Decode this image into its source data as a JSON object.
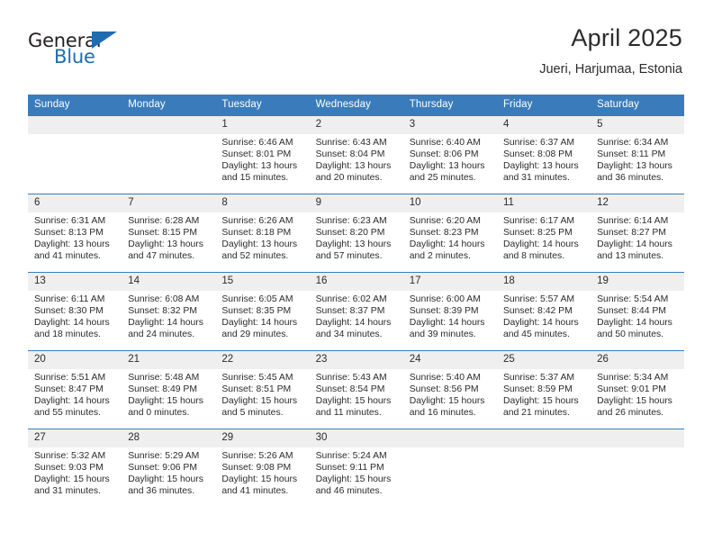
{
  "brand": {
    "name_top": "General",
    "name_bottom": "Blue",
    "triangle_icon": "triangle-icon",
    "accent_color": "#1f6cb0"
  },
  "header": {
    "title": "April 2025",
    "subtitle": "Jueri, Harjumaa, Estonia"
  },
  "theme": {
    "header_row_color": "#3a7cbb",
    "daynum_strip_color": "#efefef",
    "text_color": "#2b2b2b"
  },
  "weekdays": [
    "Sunday",
    "Monday",
    "Tuesday",
    "Wednesday",
    "Thursday",
    "Friday",
    "Saturday"
  ],
  "weeks": [
    [
      {
        "day": "",
        "sunrise": "",
        "sunset": "",
        "daylight": ""
      },
      {
        "day": "",
        "sunrise": "",
        "sunset": "",
        "daylight": ""
      },
      {
        "day": "1",
        "sunrise": "Sunrise: 6:46 AM",
        "sunset": "Sunset: 8:01 PM",
        "daylight": "Daylight: 13 hours and 15 minutes."
      },
      {
        "day": "2",
        "sunrise": "Sunrise: 6:43 AM",
        "sunset": "Sunset: 8:04 PM",
        "daylight": "Daylight: 13 hours and 20 minutes."
      },
      {
        "day": "3",
        "sunrise": "Sunrise: 6:40 AM",
        "sunset": "Sunset: 8:06 PM",
        "daylight": "Daylight: 13 hours and 25 minutes."
      },
      {
        "day": "4",
        "sunrise": "Sunrise: 6:37 AM",
        "sunset": "Sunset: 8:08 PM",
        "daylight": "Daylight: 13 hours and 31 minutes."
      },
      {
        "day": "5",
        "sunrise": "Sunrise: 6:34 AM",
        "sunset": "Sunset: 8:11 PM",
        "daylight": "Daylight: 13 hours and 36 minutes."
      }
    ],
    [
      {
        "day": "6",
        "sunrise": "Sunrise: 6:31 AM",
        "sunset": "Sunset: 8:13 PM",
        "daylight": "Daylight: 13 hours and 41 minutes."
      },
      {
        "day": "7",
        "sunrise": "Sunrise: 6:28 AM",
        "sunset": "Sunset: 8:15 PM",
        "daylight": "Daylight: 13 hours and 47 minutes."
      },
      {
        "day": "8",
        "sunrise": "Sunrise: 6:26 AM",
        "sunset": "Sunset: 8:18 PM",
        "daylight": "Daylight: 13 hours and 52 minutes."
      },
      {
        "day": "9",
        "sunrise": "Sunrise: 6:23 AM",
        "sunset": "Sunset: 8:20 PM",
        "daylight": "Daylight: 13 hours and 57 minutes."
      },
      {
        "day": "10",
        "sunrise": "Sunrise: 6:20 AM",
        "sunset": "Sunset: 8:23 PM",
        "daylight": "Daylight: 14 hours and 2 minutes."
      },
      {
        "day": "11",
        "sunrise": "Sunrise: 6:17 AM",
        "sunset": "Sunset: 8:25 PM",
        "daylight": "Daylight: 14 hours and 8 minutes."
      },
      {
        "day": "12",
        "sunrise": "Sunrise: 6:14 AM",
        "sunset": "Sunset: 8:27 PM",
        "daylight": "Daylight: 14 hours and 13 minutes."
      }
    ],
    [
      {
        "day": "13",
        "sunrise": "Sunrise: 6:11 AM",
        "sunset": "Sunset: 8:30 PM",
        "daylight": "Daylight: 14 hours and 18 minutes."
      },
      {
        "day": "14",
        "sunrise": "Sunrise: 6:08 AM",
        "sunset": "Sunset: 8:32 PM",
        "daylight": "Daylight: 14 hours and 24 minutes."
      },
      {
        "day": "15",
        "sunrise": "Sunrise: 6:05 AM",
        "sunset": "Sunset: 8:35 PM",
        "daylight": "Daylight: 14 hours and 29 minutes."
      },
      {
        "day": "16",
        "sunrise": "Sunrise: 6:02 AM",
        "sunset": "Sunset: 8:37 PM",
        "daylight": "Daylight: 14 hours and 34 minutes."
      },
      {
        "day": "17",
        "sunrise": "Sunrise: 6:00 AM",
        "sunset": "Sunset: 8:39 PM",
        "daylight": "Daylight: 14 hours and 39 minutes."
      },
      {
        "day": "18",
        "sunrise": "Sunrise: 5:57 AM",
        "sunset": "Sunset: 8:42 PM",
        "daylight": "Daylight: 14 hours and 45 minutes."
      },
      {
        "day": "19",
        "sunrise": "Sunrise: 5:54 AM",
        "sunset": "Sunset: 8:44 PM",
        "daylight": "Daylight: 14 hours and 50 minutes."
      }
    ],
    [
      {
        "day": "20",
        "sunrise": "Sunrise: 5:51 AM",
        "sunset": "Sunset: 8:47 PM",
        "daylight": "Daylight: 14 hours and 55 minutes."
      },
      {
        "day": "21",
        "sunrise": "Sunrise: 5:48 AM",
        "sunset": "Sunset: 8:49 PM",
        "daylight": "Daylight: 15 hours and 0 minutes."
      },
      {
        "day": "22",
        "sunrise": "Sunrise: 5:45 AM",
        "sunset": "Sunset: 8:51 PM",
        "daylight": "Daylight: 15 hours and 5 minutes."
      },
      {
        "day": "23",
        "sunrise": "Sunrise: 5:43 AM",
        "sunset": "Sunset: 8:54 PM",
        "daylight": "Daylight: 15 hours and 11 minutes."
      },
      {
        "day": "24",
        "sunrise": "Sunrise: 5:40 AM",
        "sunset": "Sunset: 8:56 PM",
        "daylight": "Daylight: 15 hours and 16 minutes."
      },
      {
        "day": "25",
        "sunrise": "Sunrise: 5:37 AM",
        "sunset": "Sunset: 8:59 PM",
        "daylight": "Daylight: 15 hours and 21 minutes."
      },
      {
        "day": "26",
        "sunrise": "Sunrise: 5:34 AM",
        "sunset": "Sunset: 9:01 PM",
        "daylight": "Daylight: 15 hours and 26 minutes."
      }
    ],
    [
      {
        "day": "27",
        "sunrise": "Sunrise: 5:32 AM",
        "sunset": "Sunset: 9:03 PM",
        "daylight": "Daylight: 15 hours and 31 minutes."
      },
      {
        "day": "28",
        "sunrise": "Sunrise: 5:29 AM",
        "sunset": "Sunset: 9:06 PM",
        "daylight": "Daylight: 15 hours and 36 minutes."
      },
      {
        "day": "29",
        "sunrise": "Sunrise: 5:26 AM",
        "sunset": "Sunset: 9:08 PM",
        "daylight": "Daylight: 15 hours and 41 minutes."
      },
      {
        "day": "30",
        "sunrise": "Sunrise: 5:24 AM",
        "sunset": "Sunset: 9:11 PM",
        "daylight": "Daylight: 15 hours and 46 minutes."
      },
      {
        "day": "",
        "sunrise": "",
        "sunset": "",
        "daylight": ""
      },
      {
        "day": "",
        "sunrise": "",
        "sunset": "",
        "daylight": ""
      },
      {
        "day": "",
        "sunrise": "",
        "sunset": "",
        "daylight": ""
      }
    ]
  ]
}
